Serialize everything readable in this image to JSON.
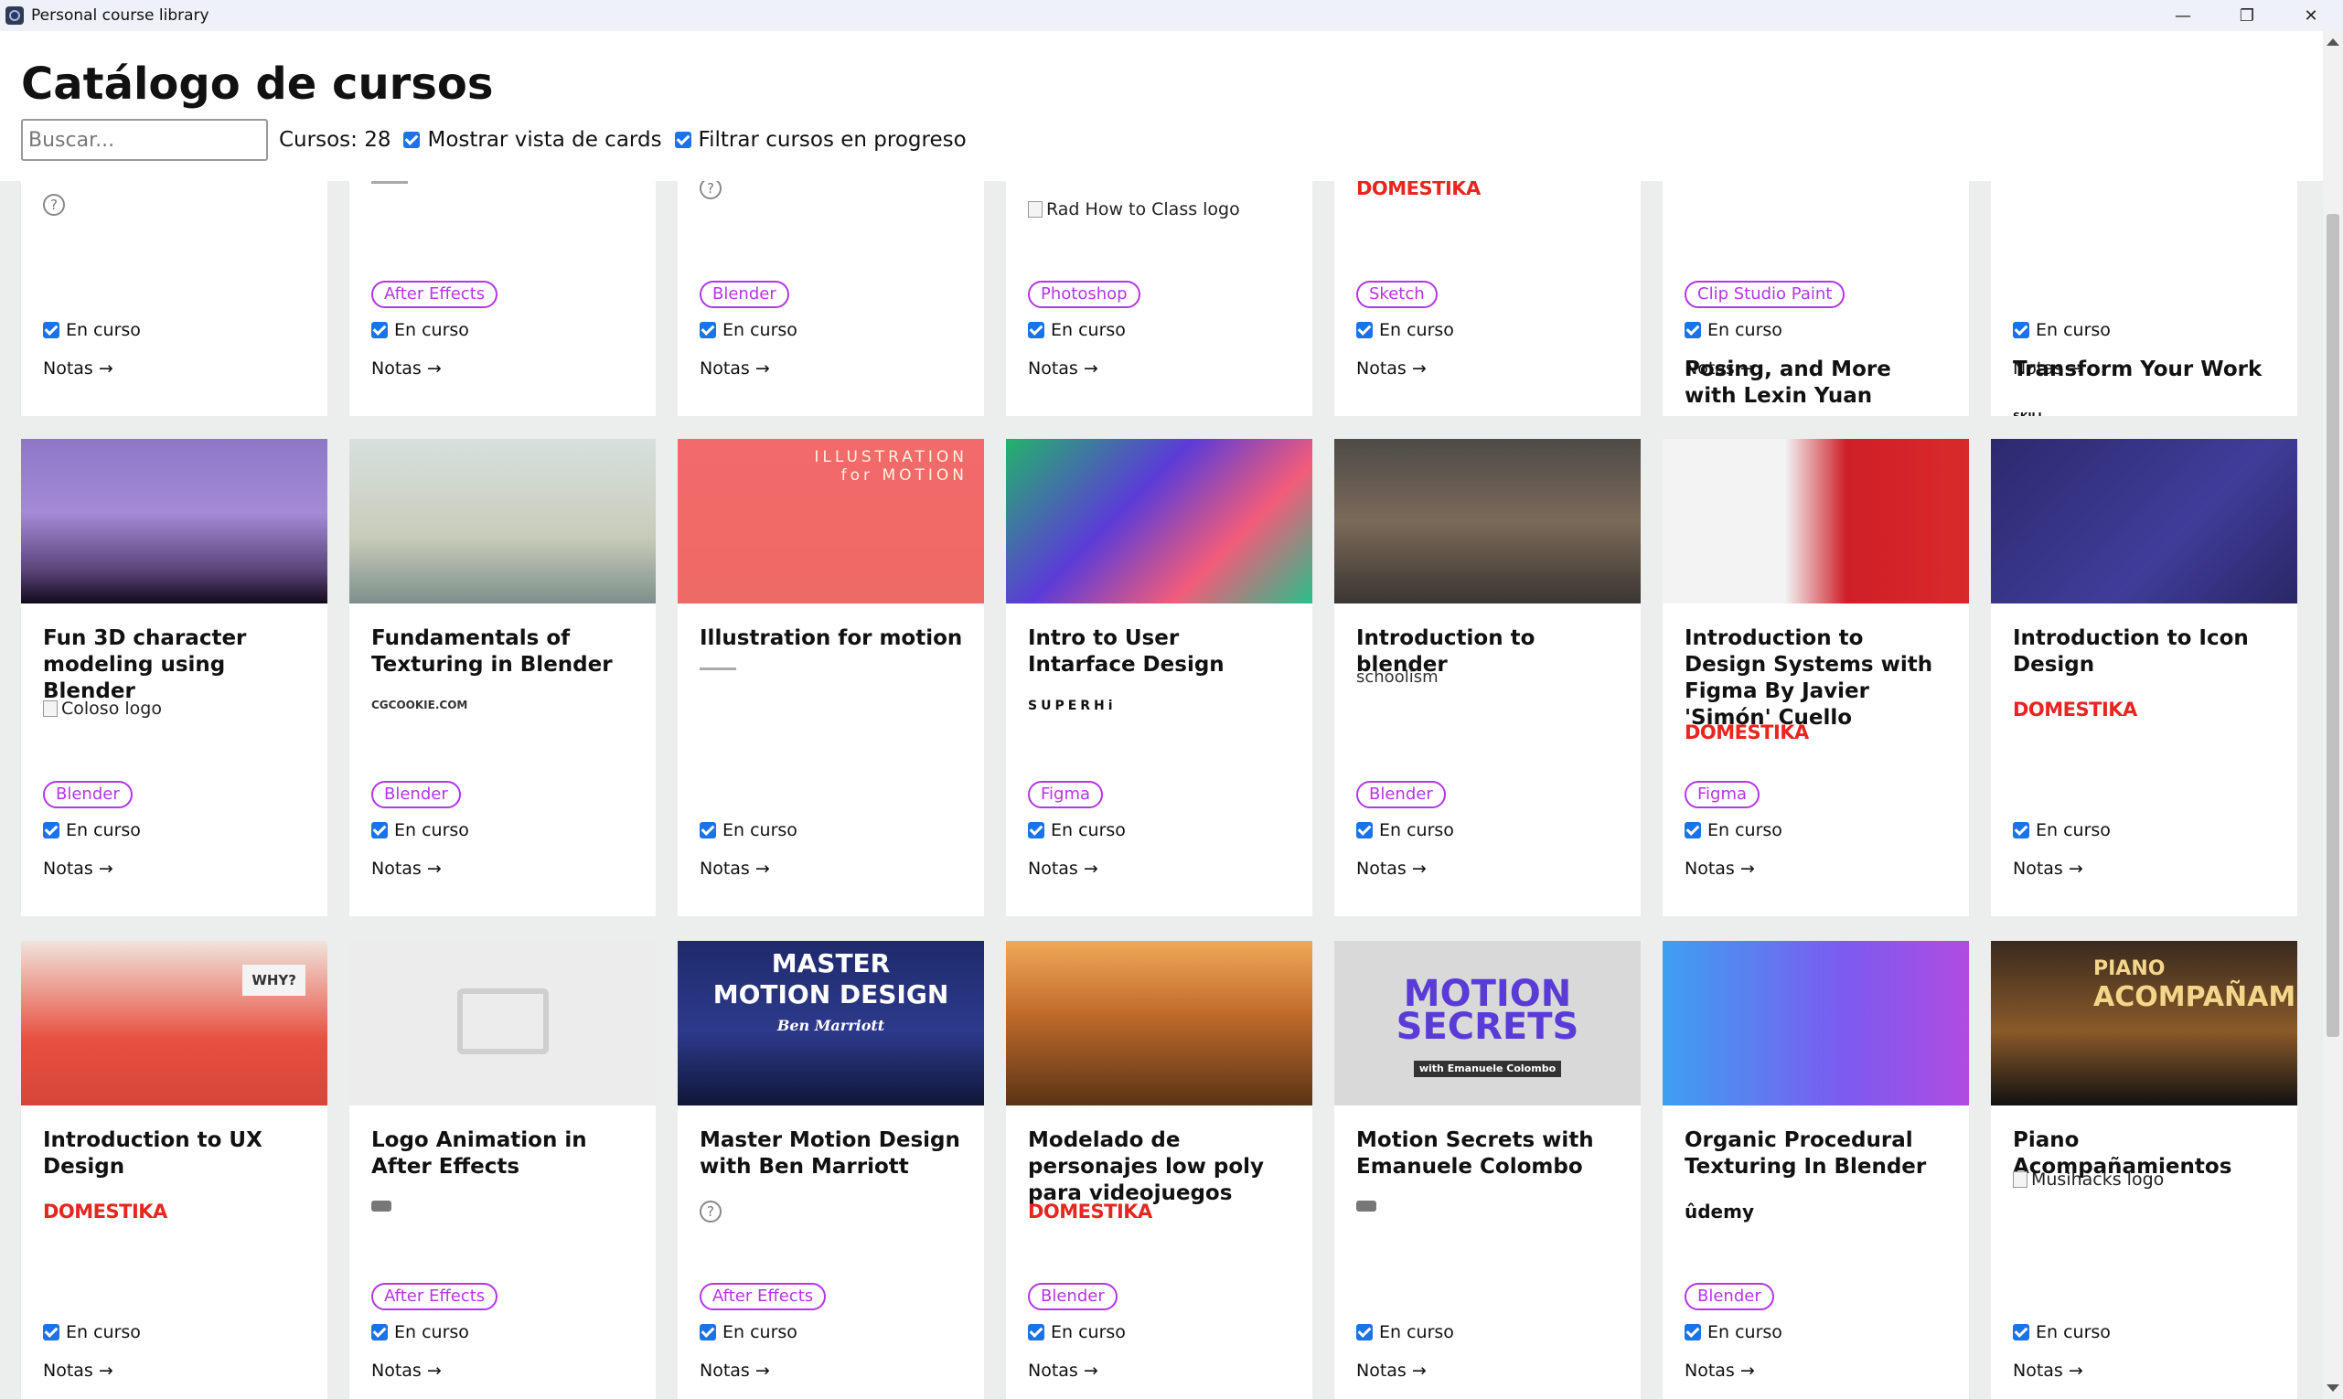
{
  "window": {
    "title": "Personal course library",
    "controls": {
      "minimize": "—",
      "restore": "❐",
      "close": "✕"
    }
  },
  "header": {
    "title": "Catálogo de cursos",
    "search_placeholder": "Buscar...",
    "count_label": "Cursos: 28",
    "toggle_cards": {
      "label": "Mostrar vista de cards",
      "checked": true
    },
    "toggle_progress": {
      "label": "Filtrar cursos en progreso",
      "checked": true
    }
  },
  "card_labels": {
    "status": "En curso",
    "notes": "Notas →"
  },
  "rows": [
    {
      "cards": [
        {
          "title": "",
          "logo": {
            "kind": "help",
            "text": "?"
          },
          "tag": ""
        },
        {
          "title": "",
          "logo": {
            "kind": "tiny",
            "text": ""
          },
          "tag": "After Effects"
        },
        {
          "title": "",
          "logo": {
            "kind": "help",
            "text": "?"
          },
          "tag": "Blender"
        },
        {
          "title": "",
          "logo": {
            "kind": "broken",
            "text": "Rad How to Class logo"
          },
          "tag": "Photoshop"
        },
        {
          "title": "",
          "logo": {
            "kind": "domestika",
            "text": "DOMESTIKA"
          },
          "tag": "Sketch"
        },
        {
          "title": "Posing, and More with Lexin Yuan",
          "logo": {
            "kind": "class101",
            "text": "CLASS101"
          },
          "tag": "Clip Studio Paint"
        },
        {
          "title": "Transform Your Work",
          "logo": {
            "kind": "skillshare",
            "text": "SKILL share."
          },
          "tag": ""
        }
      ]
    },
    {
      "cards": [
        {
          "title": "Fun 3D character modeling using Blender",
          "logo": {
            "kind": "broken",
            "text": "Coloso logo"
          },
          "tag": "Blender"
        },
        {
          "title": "Fundamentals of Texturing in Blender",
          "logo": {
            "kind": "cgcookie",
            "text": "CGCOOKIE.COM"
          },
          "tag": "Blender"
        },
        {
          "title": "Illustration for motion",
          "logo": {
            "kind": "tiny",
            "text": ""
          },
          "tag": "",
          "thumb_text": [
            "ILLUSTRATION",
            "for MOTION"
          ]
        },
        {
          "title": "Intro to User Intarface Design",
          "logo": {
            "kind": "superhi",
            "text": "SUPERHi"
          },
          "tag": "Figma"
        },
        {
          "title": "Introduction to blender",
          "logo": {
            "kind": "schoolism",
            "text": "schoolism"
          },
          "tag": "Blender"
        },
        {
          "title": "Introduction to Design Systems with Figma By Javier 'Simón' Cuello",
          "logo": {
            "kind": "domestika",
            "text": "DOMESTIKA"
          },
          "tag": "Figma"
        },
        {
          "title": "Introduction to Icon Design",
          "logo": {
            "kind": "domestika",
            "text": "DOMESTIKA"
          },
          "tag": ""
        }
      ]
    },
    {
      "cards": [
        {
          "title": "Introduction to UX Design",
          "logo": {
            "kind": "domestika",
            "text": "DOMESTIKA"
          },
          "tag": "",
          "thumb_text": [
            "WHY?"
          ]
        },
        {
          "title": "Logo Animation in After Effects",
          "logo": {
            "kind": "small-icon",
            "text": ""
          },
          "tag": "After Effects"
        },
        {
          "title": "Master Motion Design with Ben Marriott",
          "logo": {
            "kind": "help",
            "text": "?"
          },
          "tag": "After Effects",
          "thumb_text": [
            "MASTER",
            "MOTION DESIGN",
            "Ben Marriott"
          ]
        },
        {
          "title": "Modelado de personajes low poly para videojuegos",
          "logo": {
            "kind": "domestika",
            "text": "DOMESTIKA"
          },
          "tag": "Blender"
        },
        {
          "title": "Motion Secrets with Emanuele Colombo",
          "logo": {
            "kind": "small-icon",
            "text": ""
          },
          "tag": "",
          "thumb_text": [
            "MOTION",
            "SECRETS",
            "with Emanuele Colombo"
          ]
        },
        {
          "title": "Organic Procedural Texturing In Blender",
          "logo": {
            "kind": "udemy",
            "text": "ûdemy"
          },
          "tag": "Blender"
        },
        {
          "title": "Piano Acompañamientos",
          "logo": {
            "kind": "broken",
            "text": "Musihacks logo"
          },
          "tag": "",
          "thumb_text": [
            "PIANO",
            "ACOMPAÑAMIENTOS"
          ]
        }
      ]
    }
  ],
  "colors": {
    "tag": "#b535e8",
    "checkbox": "#1a73e8",
    "domestika": "#e8251f",
    "background": "#eceded"
  }
}
